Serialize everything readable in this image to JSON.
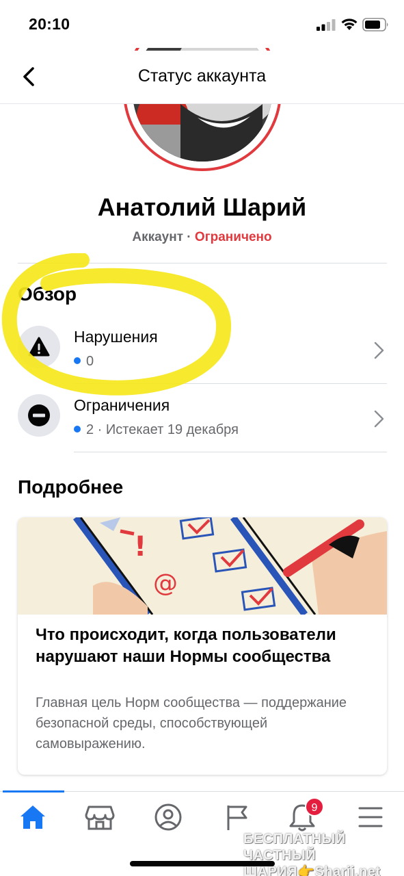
{
  "status_bar": {
    "time": "20:10"
  },
  "header": {
    "title": "Статус аккаунта"
  },
  "profile": {
    "name": "Анатолий Шарий",
    "account_label": "Аккаунт",
    "separator": " · ",
    "status": "Ограничено"
  },
  "overview": {
    "title": "Обзор",
    "items": [
      {
        "label": "Нарушения",
        "meta": "0"
      },
      {
        "label": "Ограничения",
        "meta": "2 · Истекает 19 декабря"
      }
    ]
  },
  "more": {
    "title": "Подробнее",
    "card": {
      "title": "Что происходит, когда пользователи нарушают наши Нормы сообщества",
      "description": "Главная цель Норм сообщества — поддержание безопасной среды, способствующей самовыражению."
    }
  },
  "tabbar": {
    "tabs": [
      "home-icon",
      "marketplace-icon",
      "profile-icon",
      "pages-flag-icon",
      "notifications-icon",
      "menu-icon"
    ],
    "notification_count": "9"
  },
  "watermark": {
    "line1": "БЕСПЛАТНЫЙ ЧАСТНЫЙ",
    "line2": "ШАРИЯ👉Sharij.net"
  },
  "colors": {
    "accent": "#1877f2",
    "danger": "#e0393e",
    "highlight": "#f5e71c",
    "muted": "#65676b"
  }
}
